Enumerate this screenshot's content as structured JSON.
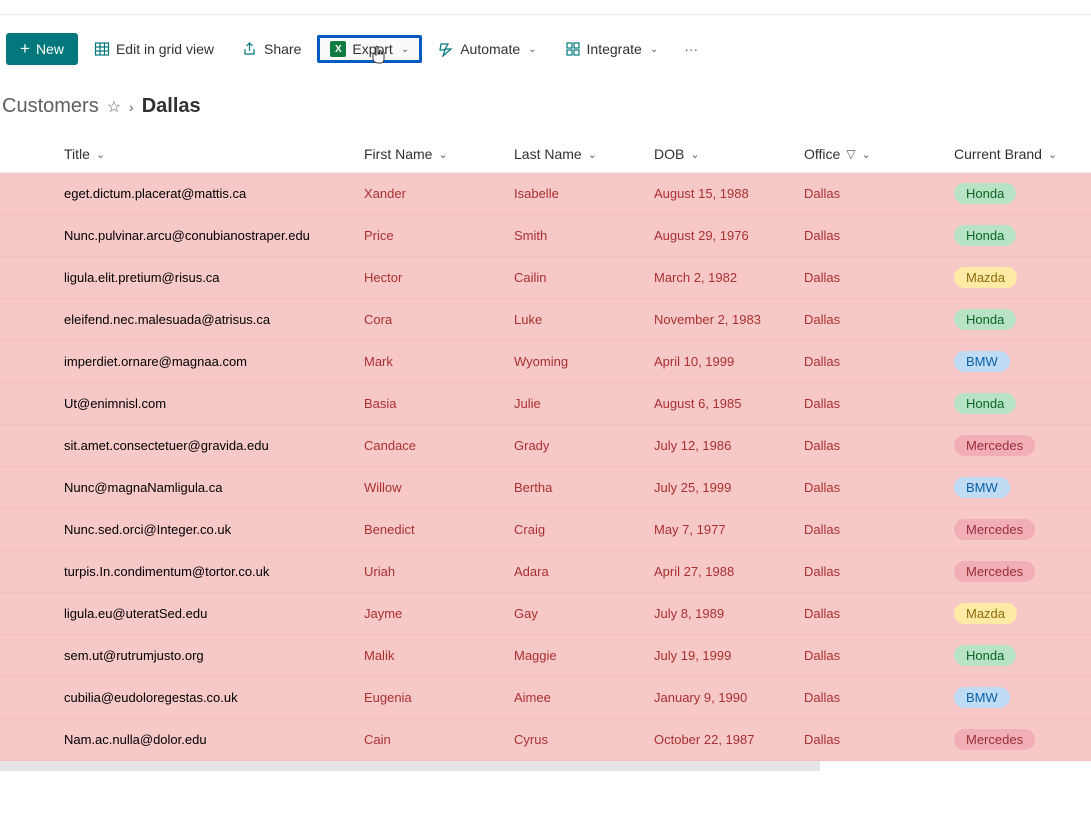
{
  "toolbar": {
    "new_label": "New",
    "edit_grid_label": "Edit in grid view",
    "share_label": "Share",
    "export_label": "Export",
    "automate_label": "Automate",
    "integrate_label": "Integrate"
  },
  "breadcrumb": {
    "parent": "Customers",
    "current": "Dallas"
  },
  "columns": {
    "title": "Title",
    "first_name": "First Name",
    "last_name": "Last Name",
    "dob": "DOB",
    "office": "Office",
    "current_brand": "Current Brand"
  },
  "rows": [
    {
      "title": "eget.dictum.placerat@mattis.ca",
      "first_name": "Xander",
      "last_name": "Isabelle",
      "dob": "August 15, 1988",
      "office": "Dallas",
      "brand": "Honda"
    },
    {
      "title": "Nunc.pulvinar.arcu@conubianostraper.edu",
      "first_name": "Price",
      "last_name": "Smith",
      "dob": "August 29, 1976",
      "office": "Dallas",
      "brand": "Honda"
    },
    {
      "title": "ligula.elit.pretium@risus.ca",
      "first_name": "Hector",
      "last_name": "Cailin",
      "dob": "March 2, 1982",
      "office": "Dallas",
      "brand": "Mazda"
    },
    {
      "title": "eleifend.nec.malesuada@atrisus.ca",
      "first_name": "Cora",
      "last_name": "Luke",
      "dob": "November 2, 1983",
      "office": "Dallas",
      "brand": "Honda"
    },
    {
      "title": "imperdiet.ornare@magnaa.com",
      "first_name": "Mark",
      "last_name": "Wyoming",
      "dob": "April 10, 1999",
      "office": "Dallas",
      "brand": "BMW"
    },
    {
      "title": "Ut@enimnisl.com",
      "first_name": "Basia",
      "last_name": "Julie",
      "dob": "August 6, 1985",
      "office": "Dallas",
      "brand": "Honda"
    },
    {
      "title": "sit.amet.consectetuer@gravida.edu",
      "first_name": "Candace",
      "last_name": "Grady",
      "dob": "July 12, 1986",
      "office": "Dallas",
      "brand": "Mercedes"
    },
    {
      "title": "Nunc@magnaNamligula.ca",
      "first_name": "Willow",
      "last_name": "Bertha",
      "dob": "July 25, 1999",
      "office": "Dallas",
      "brand": "BMW"
    },
    {
      "title": "Nunc.sed.orci@Integer.co.uk",
      "first_name": "Benedict",
      "last_name": "Craig",
      "dob": "May 7, 1977",
      "office": "Dallas",
      "brand": "Mercedes"
    },
    {
      "title": "turpis.In.condimentum@tortor.co.uk",
      "first_name": "Uriah",
      "last_name": "Adara",
      "dob": "April 27, 1988",
      "office": "Dallas",
      "brand": "Mercedes"
    },
    {
      "title": "ligula.eu@uteratSed.edu",
      "first_name": "Jayme",
      "last_name": "Gay",
      "dob": "July 8, 1989",
      "office": "Dallas",
      "brand": "Mazda"
    },
    {
      "title": "sem.ut@rutrumjusto.org",
      "first_name": "Malik",
      "last_name": "Maggie",
      "dob": "July 19, 1999",
      "office": "Dallas",
      "brand": "Honda"
    },
    {
      "title": "cubilia@eudoloregestas.co.uk",
      "first_name": "Eugenia",
      "last_name": "Aimee",
      "dob": "January 9, 1990",
      "office": "Dallas",
      "brand": "BMW"
    },
    {
      "title": "Nam.ac.nulla@dolor.edu",
      "first_name": "Cain",
      "last_name": "Cyrus",
      "dob": "October 22, 1987",
      "office": "Dallas",
      "brand": "Mercedes"
    }
  ],
  "brand_styles": {
    "Honda": "pill-honda",
    "Mazda": "pill-mazda",
    "BMW": "pill-bmw",
    "Mercedes": "pill-mercedes"
  }
}
